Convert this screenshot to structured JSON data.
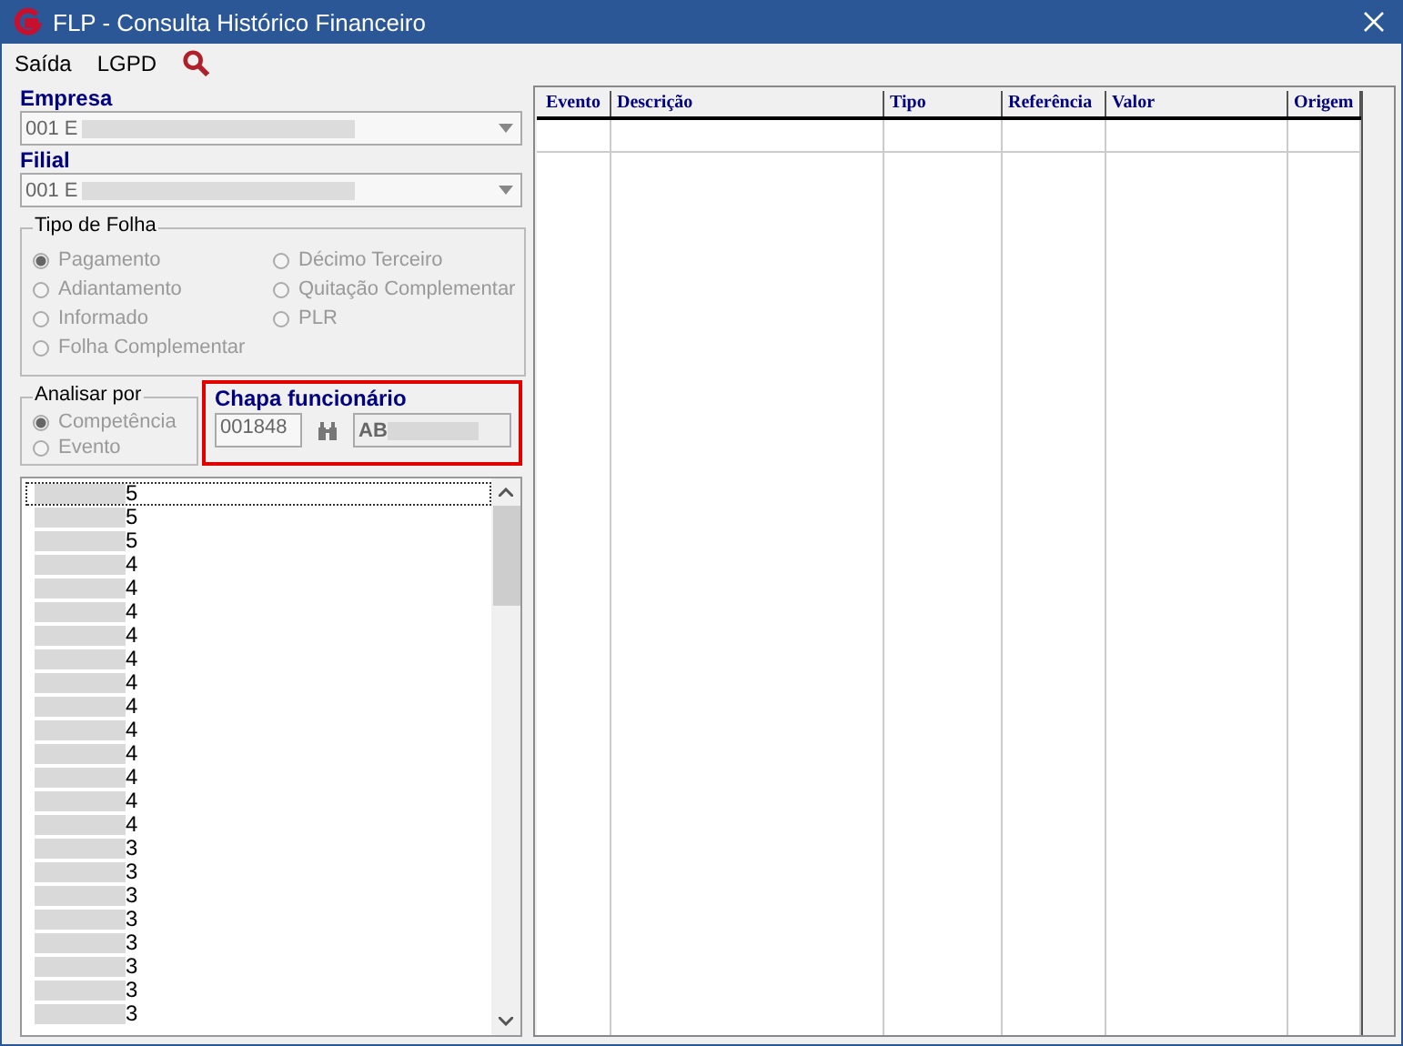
{
  "window": {
    "title": "FLP - Consulta Histórico Financeiro"
  },
  "menu": [
    "Saída",
    "LGPD"
  ],
  "empresa": {
    "label": "Empresa",
    "value": "001 E"
  },
  "filial": {
    "label": "Filial",
    "value": "001 E"
  },
  "tipo_de_folha": {
    "label": "Tipo de Folha",
    "options": [
      {
        "label": "Pagamento",
        "selected": true,
        "disabled": true
      },
      {
        "label": "Décimo Terceiro",
        "selected": false,
        "disabled": true
      },
      {
        "label": "Adiantamento",
        "selected": false,
        "disabled": true
      },
      {
        "label": "Quitação Complementar",
        "selected": false,
        "disabled": true
      },
      {
        "label": "Informado",
        "selected": false,
        "disabled": true
      },
      {
        "label": "PLR",
        "selected": false,
        "disabled": true
      },
      {
        "label": "Folha Complementar",
        "selected": false,
        "disabled": true
      }
    ]
  },
  "analisar_por": {
    "label": "Analisar por",
    "options": [
      {
        "label": "Competência",
        "selected": true,
        "disabled": true
      },
      {
        "label": "Evento",
        "selected": false,
        "disabled": true
      }
    ]
  },
  "chapa": {
    "label": "Chapa funcionário",
    "value": "001848",
    "name": "AB"
  },
  "list": [
    {
      "text": "5",
      "selected": true
    },
    {
      "text": "5",
      "selected": false
    },
    {
      "text": "5",
      "selected": false
    },
    {
      "text": "4",
      "selected": false
    },
    {
      "text": "4",
      "selected": false
    },
    {
      "text": "4",
      "selected": false
    },
    {
      "text": "4",
      "selected": false
    },
    {
      "text": "4",
      "selected": false
    },
    {
      "text": "4",
      "selected": false
    },
    {
      "text": "4",
      "selected": false
    },
    {
      "text": "4",
      "selected": false
    },
    {
      "text": "4",
      "selected": false
    },
    {
      "text": "4",
      "selected": false
    },
    {
      "text": "4",
      "selected": false
    },
    {
      "text": "4",
      "selected": false
    },
    {
      "text": "3",
      "selected": false
    },
    {
      "text": "3",
      "selected": false
    },
    {
      "text": "3",
      "selected": false
    },
    {
      "text": "3",
      "selected": false
    },
    {
      "text": "3",
      "selected": false
    },
    {
      "text": "3",
      "selected": false
    },
    {
      "text": "3",
      "selected": false
    },
    {
      "text": "3",
      "selected": false
    }
  ],
  "table": {
    "columns": [
      "Evento",
      "Descrição",
      "Tipo",
      "Referência",
      "Valor",
      "Origem"
    ]
  }
}
